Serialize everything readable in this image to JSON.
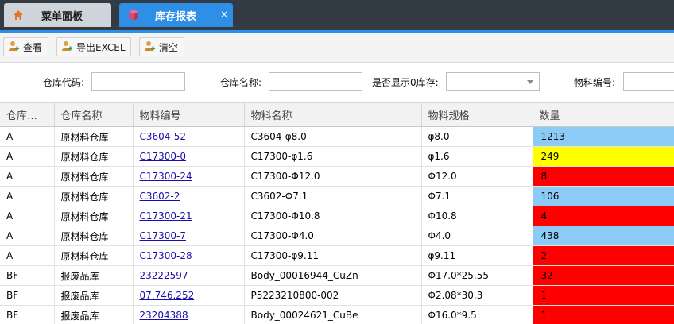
{
  "tabs": {
    "menu_label": "菜单面板",
    "report_label": "库存报表",
    "close_glyph": "×"
  },
  "toolbar": {
    "view_label": "查看",
    "export_label": "导出EXCEL",
    "clear_label": "清空"
  },
  "filters": {
    "warehouse_code_label": "仓库代码:",
    "warehouse_code_value": "",
    "warehouse_name_label": "仓库名称:",
    "warehouse_name_value": "",
    "show_zero_label": "是否显示0库存:",
    "show_zero_value": "",
    "material_code_label": "物料编号:",
    "material_code_value": ""
  },
  "grid": {
    "headers": [
      "仓库…",
      "仓库名称",
      "物料编号",
      "物料名称",
      "物料规格",
      "数量"
    ],
    "rows": [
      {
        "code": "A",
        "name": "原材料仓库",
        "material_no": "C3604-52",
        "material_name": "C3604-φ8.0",
        "spec": "φ8.0",
        "qty": "1213",
        "status": "blue"
      },
      {
        "code": "A",
        "name": "原材料仓库",
        "material_no": "C17300-0",
        "material_name": "C17300-φ1.6",
        "spec": "φ1.6",
        "qty": "249",
        "status": "yellow"
      },
      {
        "code": "A",
        "name": "原材料仓库",
        "material_no": "C17300-24",
        "material_name": "C17300-Φ12.0",
        "spec": "Φ12.0",
        "qty": "8",
        "status": "red"
      },
      {
        "code": "A",
        "name": "原材料仓库",
        "material_no": "C3602-2",
        "material_name": "C3602-Φ7.1",
        "spec": "Φ7.1",
        "qty": "106",
        "status": "blue"
      },
      {
        "code": "A",
        "name": "原材料仓库",
        "material_no": "C17300-21",
        "material_name": "C17300-Φ10.8",
        "spec": "Φ10.8",
        "qty": "4",
        "status": "red"
      },
      {
        "code": "A",
        "name": "原材料仓库",
        "material_no": "C17300-7",
        "material_name": "C17300-Φ4.0",
        "spec": "Φ4.0",
        "qty": "438",
        "status": "blue"
      },
      {
        "code": "A",
        "name": "原材料仓库",
        "material_no": "C17300-28",
        "material_name": "C17300-φ9.11",
        "spec": "φ9.11",
        "qty": "2",
        "status": "red"
      },
      {
        "code": "BF",
        "name": "报废品库",
        "material_no": "23222597",
        "material_name": "Body_00016944_CuZn",
        "spec": "Φ17.0*25.55",
        "qty": "32",
        "status": "red"
      },
      {
        "code": "BF",
        "name": "报废品库",
        "material_no": "07.746.252",
        "material_name": "P5223210800-002",
        "spec": "Φ2.08*30.3",
        "qty": "1",
        "status": "red"
      },
      {
        "code": "BF",
        "name": "报废品库",
        "material_no": "23204388",
        "material_name": "Body_00024621_CuBe",
        "spec": "Φ16.0*9.5",
        "qty": "1",
        "status": "red"
      }
    ]
  },
  "colors": {
    "tab_bar": "#323a44",
    "accent": "#2f8fe6",
    "qty_blue": "#8ccbf5",
    "qty_yellow": "#ffff00",
    "qty_red": "#ff0000"
  },
  "icons": [
    "home-icon",
    "report-cube-icon",
    "add-user-icon"
  ]
}
